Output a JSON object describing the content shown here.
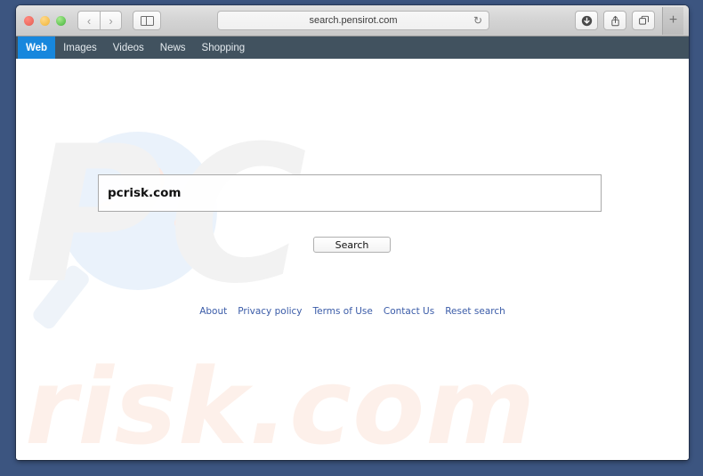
{
  "browser": {
    "url": "search.pensirot.com",
    "traffic_lights": [
      "close",
      "minimize",
      "zoom"
    ],
    "back_glyph": "‹",
    "forward_glyph": "›",
    "reload_glyph": "↻",
    "new_tab_glyph": "+",
    "sidebar_icon": "sidebar-icon",
    "download_icon": "download-icon",
    "share_icon": "share-icon",
    "tabs_icon": "tabs-overview-icon"
  },
  "site_nav": {
    "items": [
      {
        "label": "Web",
        "active": true
      },
      {
        "label": "Images",
        "active": false
      },
      {
        "label": "Videos",
        "active": false
      },
      {
        "label": "News",
        "active": false
      },
      {
        "label": "Shopping",
        "active": false
      }
    ]
  },
  "search": {
    "value": "pcrisk.com",
    "placeholder": "",
    "button_label": "Search"
  },
  "footer": {
    "links": [
      "About",
      "Privacy policy",
      "Terms of Use",
      "Contact Us",
      "Reset search"
    ]
  },
  "watermark": {
    "top_text": "PC",
    "bottom_text": "risk.com"
  },
  "colors": {
    "desktop_background": "#3c5580",
    "nav_bar": "#41525f",
    "active_tab": "#1787dd",
    "link": "#3b5ca8",
    "watermark_gray": "#f2f2f2",
    "watermark_peach": "#fdf0ea",
    "glass_blue": "#eaf2fb",
    "bubble_pink": "#fdeae4"
  }
}
